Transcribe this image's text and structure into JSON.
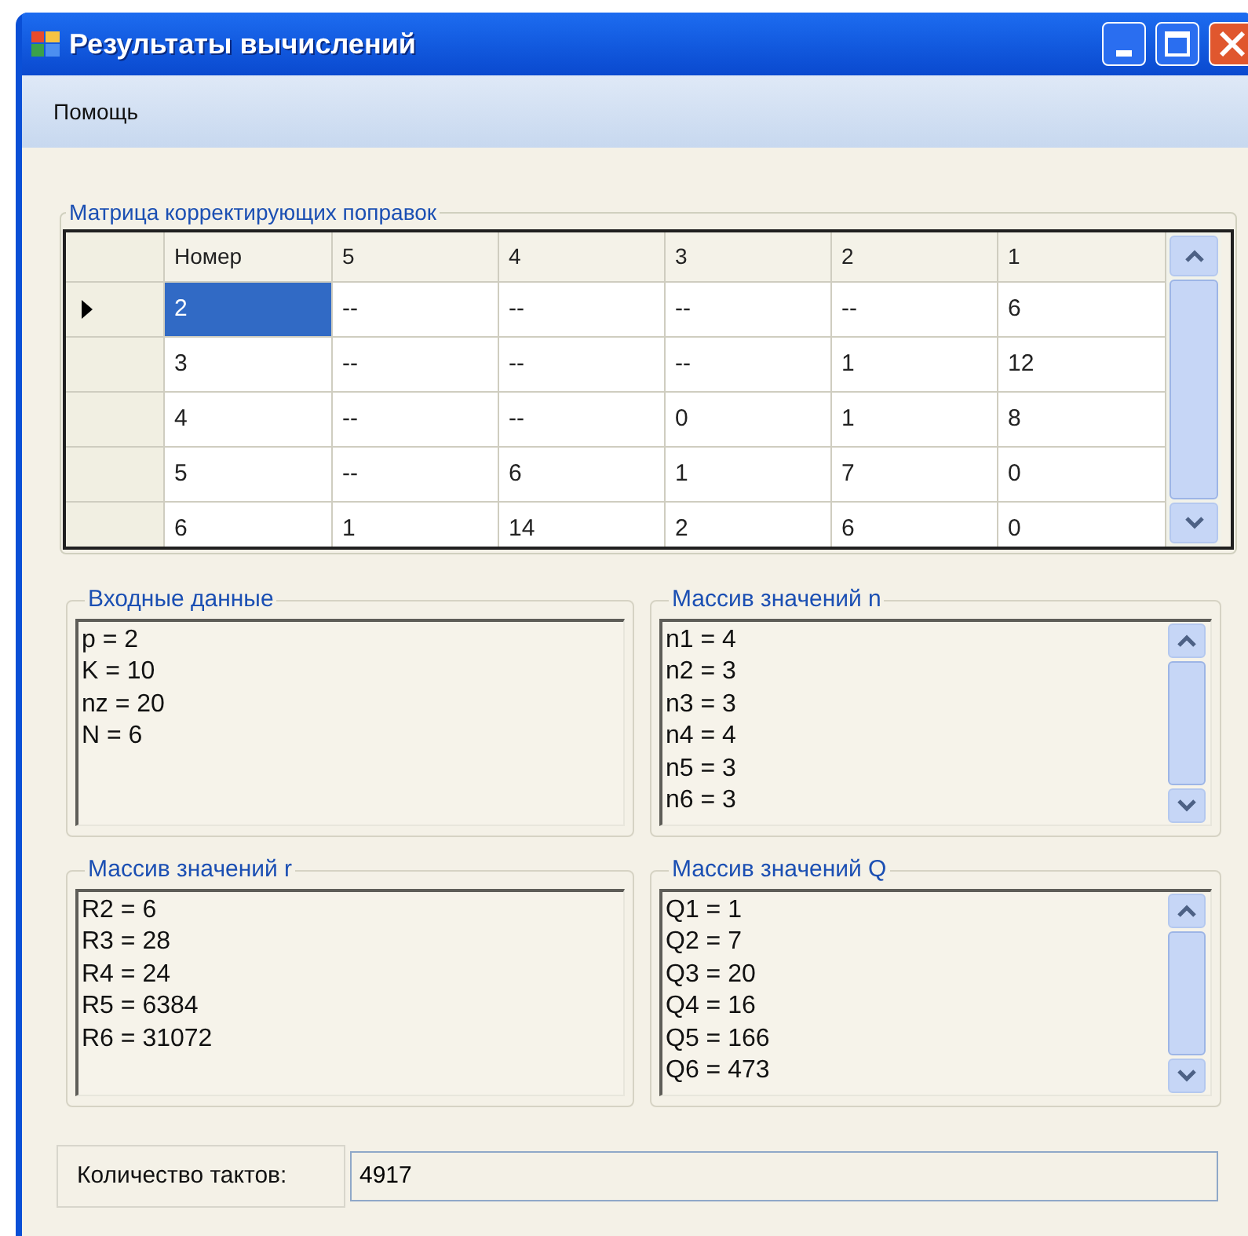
{
  "window": {
    "title": "Результаты вычислений"
  },
  "menu": [
    {
      "label": "Помощь"
    }
  ],
  "matrix": {
    "title": "Матрица корректирующих поправок",
    "columns": [
      "Номер",
      "5",
      "4",
      "3",
      "2",
      "1"
    ],
    "rows": [
      {
        "current": true,
        "cells": [
          {
            "text": "2",
            "selected": true
          },
          {
            "text": "--",
            "selected": false
          },
          {
            "text": "--",
            "selected": false
          },
          {
            "text": "--",
            "selected": false
          },
          {
            "text": "--",
            "selected": false
          },
          {
            "text": "6",
            "selected": false
          }
        ]
      },
      {
        "current": false,
        "cells": [
          {
            "text": "3",
            "selected": false
          },
          {
            "text": "--",
            "selected": false
          },
          {
            "text": "--",
            "selected": false
          },
          {
            "text": "--",
            "selected": false
          },
          {
            "text": "1",
            "selected": false
          },
          {
            "text": "12",
            "selected": false
          }
        ]
      },
      {
        "current": false,
        "cells": [
          {
            "text": "4",
            "selected": false
          },
          {
            "text": "--",
            "selected": false
          },
          {
            "text": "--",
            "selected": false
          },
          {
            "text": "0",
            "selected": false
          },
          {
            "text": "1",
            "selected": false
          },
          {
            "text": "8",
            "selected": false
          }
        ]
      },
      {
        "current": false,
        "cells": [
          {
            "text": "5",
            "selected": false
          },
          {
            "text": "--",
            "selected": false
          },
          {
            "text": "6",
            "selected": false
          },
          {
            "text": "1",
            "selected": false
          },
          {
            "text": "7",
            "selected": false
          },
          {
            "text": "0",
            "selected": false
          }
        ]
      },
      {
        "current": false,
        "cells": [
          {
            "text": "6",
            "selected": false
          },
          {
            "text": "1",
            "selected": false
          },
          {
            "text": "14",
            "selected": false
          },
          {
            "text": "2",
            "selected": false
          },
          {
            "text": "6",
            "selected": false
          },
          {
            "text": "0",
            "selected": false
          }
        ]
      }
    ]
  },
  "panels": [
    {
      "title": "Входные данные",
      "scrollable": false,
      "lines": [
        "p = 2",
        "K = 10",
        "nz = 20",
        "N = 6"
      ]
    },
    {
      "title": "Массив значений n",
      "scrollable": true,
      "lines": [
        "n1 = 4",
        "n2 = 3",
        "n3 = 3",
        "n4 = 4",
        "n5 = 3",
        "n6 = 3"
      ]
    },
    {
      "title": "Массив значений r",
      "scrollable": false,
      "lines": [
        "R2 = 6",
        "R3 = 28",
        "R4 = 24",
        "R5 = 6384",
        "R6 = 31072"
      ]
    },
    {
      "title": "Массив значений Q",
      "scrollable": true,
      "lines": [
        "Q1 = 1",
        "Q2 = 7",
        "Q3 = 20",
        "Q4 = 16",
        "Q5 = 166",
        "Q6 = 473"
      ]
    }
  ],
  "ticks": {
    "label": "Количество тактов:",
    "value": "4917"
  }
}
